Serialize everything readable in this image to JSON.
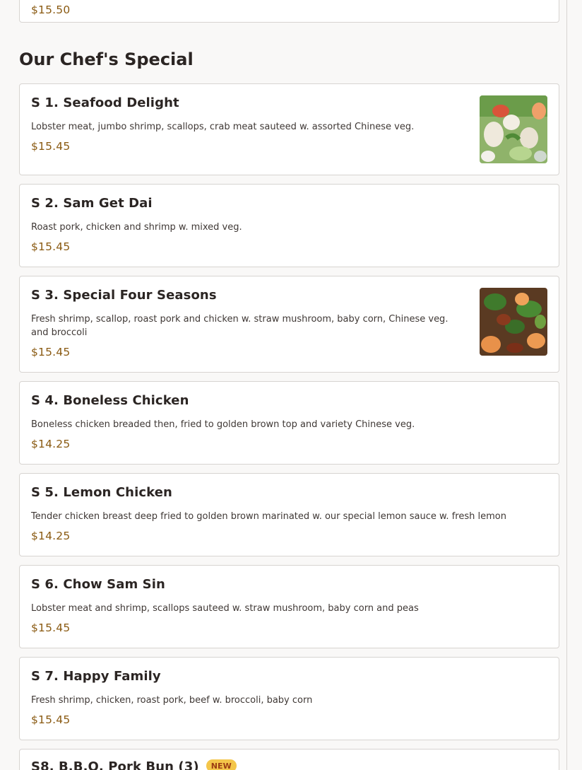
{
  "previous_item": {
    "price": "$15.50"
  },
  "section": {
    "title": "Our Chef's Special",
    "items": [
      {
        "name": "S 1. Seafood Delight",
        "desc": "Lobster meat, jumbo shrimp, scallops, crab meat sauteed w. assorted Chinese veg.",
        "price": "$15.45",
        "image": "seafood-delight-photo"
      },
      {
        "name": "S 2. Sam Get Dai",
        "desc": "Roast pork, chicken and shrimp w. mixed veg.",
        "price": "$15.45"
      },
      {
        "name": "S 3. Special Four Seasons",
        "desc": "Fresh shrimp, scallop, roast pork and chicken w. straw mushroom, baby corn, Chinese veg. and broccoli",
        "price": "$15.45",
        "image": "four-seasons-photo"
      },
      {
        "name": "S 4. Boneless Chicken",
        "desc": "Boneless chicken breaded then, fried to golden brown top and variety Chinese veg.",
        "price": "$14.25"
      },
      {
        "name": "S 5. Lemon Chicken",
        "desc": "Tender chicken breast deep fried to golden brown marinated w. our special lemon sauce w. fresh lemon",
        "price": "$14.25"
      },
      {
        "name": "S 6. Chow Sam Sin",
        "desc": "Lobster meat and shrimp, scallops sauteed w. straw mushroom, baby corn and peas",
        "price": "$15.45"
      },
      {
        "name": "S 7. Happy Family",
        "desc": "Fresh shrimp, chicken, roast pork, beef w. broccoli, baby corn",
        "price": "$15.45"
      },
      {
        "name": "S8. B.B.Q. Pork Bun (3)",
        "badge": "NEW"
      }
    ]
  },
  "colors": {
    "price": "#8a5a12",
    "badge_bg": "#f4c64a",
    "badge_text": "#9c3d13",
    "border": "#d7d4d1"
  }
}
